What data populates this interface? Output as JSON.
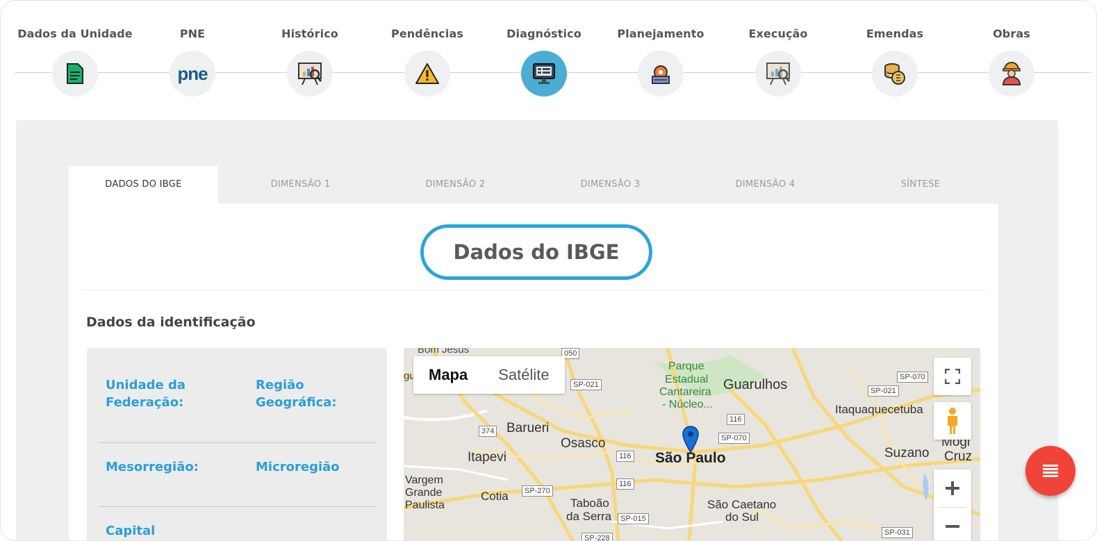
{
  "stepper": {
    "steps": [
      {
        "label": "Dados da Unidade",
        "icon": "document-icon"
      },
      {
        "label": "PNE",
        "icon": "pne-logo-icon",
        "icon_text": "pne"
      },
      {
        "label": "Histórico",
        "icon": "presentation-chart-icon"
      },
      {
        "label": "Pendências",
        "icon": "warning-icon"
      },
      {
        "label": "Diagnóstico",
        "icon": "monitor-icon",
        "active": true
      },
      {
        "label": "Planejamento",
        "icon": "planning-gear-icon"
      },
      {
        "label": "Execução",
        "icon": "presentation-chart-icon"
      },
      {
        "label": "Emendas",
        "icon": "coins-icon"
      },
      {
        "label": "Obras",
        "icon": "worker-icon"
      }
    ],
    "active_color": "#4badd3"
  },
  "tabs": [
    {
      "label": "DADOS DO IBGE",
      "active": true
    },
    {
      "label": "DIMENSÃO 1"
    },
    {
      "label": "DIMENSÃO 2"
    },
    {
      "label": "DIMENSÃO 3"
    },
    {
      "label": "DIMENSÃO 4"
    },
    {
      "label": "SÍNTESE"
    }
  ],
  "page_title": "Dados do IBGE",
  "section_title": "Dados da identificação",
  "info": {
    "unidade_federacao": "Unidade da Federação:",
    "regiao_geografica": "Região Geográfica:",
    "mesorregiao": "Mesorregião:",
    "microregiao": "Microregião",
    "capital": "Capital",
    "label_color": "#2a9fd8"
  },
  "map": {
    "type_buttons": {
      "map": "Mapa",
      "satellite": "Satélite"
    },
    "places": {
      "bom_jesus": "Bom Jesus",
      "parque": "Parque",
      "estadual": "Estadual",
      "cantareira": "Cantareira",
      "nucleo": "- Núcleo...",
      "guarulhos": "Guarulhos",
      "itaquaquecetuba": "Itaquaquecetuba",
      "barueri": "Barueri",
      "osasco": "Osasco",
      "sao_paulo": "São Paulo",
      "itapevi": "Itapevi",
      "suzano": "Suzano",
      "mogi": "Mogi",
      "cruz": "Cruz",
      "vargem": "Vargem",
      "grande": "Grande",
      "paulista": "Paulista",
      "cotia": "Cotia",
      "taboao": "Taboão",
      "da_serra": "da Serra",
      "sao_caetano": "São Caetano",
      "do_sul": "do Sul",
      "gu": "gu"
    },
    "shields": {
      "r050": "050",
      "sp021a": "SP-021",
      "sp070a": "SP-070",
      "sp021b": "SP-021",
      "r116a": "116",
      "sp070b": "SP-070",
      "r374": "374",
      "r116b": "116",
      "r116c": "116",
      "sp270": "SP-270",
      "sp015": "SP-015",
      "sp228": "SP-228",
      "sp031": "SP-031"
    },
    "controls": [
      "fullscreen-icon",
      "pegman-icon",
      "zoom-in-icon",
      "zoom-out-icon"
    ],
    "pin_color": "#1a73e8"
  },
  "fab": {
    "icon": "menu-icon",
    "color": "#f04438"
  }
}
